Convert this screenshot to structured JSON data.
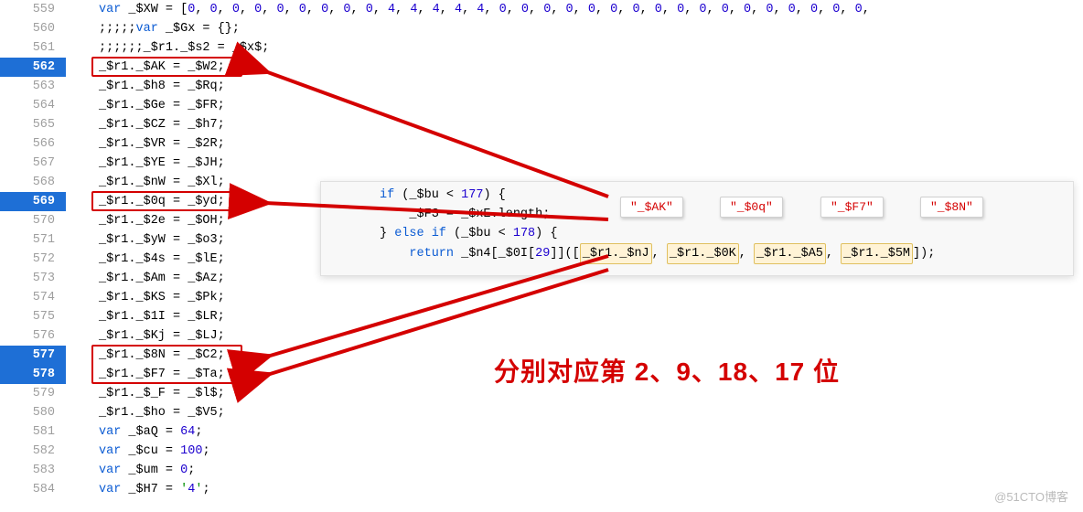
{
  "gutter": {
    "start": 559,
    "end": 584,
    "highlighted": [
      562,
      569,
      577,
      578
    ]
  },
  "code_lines": {
    "559": {
      "prefix": "var ",
      "body": "_$XW = [0, 0, 0, 0, 0, 0, 0, 0, 0, 4, 4, 4, 4, 4, 0, 0, 0, 0, 0, 0, 0, 0, 0, 0, 0, 0, 0, 0, 0, 0, 0,"
    },
    "560": {
      "body": ";;;;;var _$Gx = {};"
    },
    "561": {
      "body": ";;;;;;_$r1._$s2 = _$x$;"
    },
    "562": {
      "body": "_$r1._$AK = _$W2;"
    },
    "563": {
      "body": "_$r1._$h8 = _$Rq;"
    },
    "564": {
      "body": "_$r1._$Ge = _$FR;"
    },
    "565": {
      "body": "_$r1._$CZ = _$h7;"
    },
    "566": {
      "body": "_$r1._$VR = _$2R;"
    },
    "567": {
      "body": "_$r1._$YE = _$JH;"
    },
    "568": {
      "body": "_$r1._$nW = _$Xl;"
    },
    "569": {
      "body": "_$r1._$0q = _$yd;"
    },
    "570": {
      "body": "_$r1._$2e = _$OH;"
    },
    "571": {
      "body": "_$r1._$yW = _$o3;"
    },
    "572": {
      "body": "_$r1._$4s = _$lE;"
    },
    "573": {
      "body": "_$r1._$Am = _$Az;"
    },
    "574": {
      "body": "_$r1._$KS = _$Pk;"
    },
    "575": {
      "body": "_$r1._$1I = _$LR;"
    },
    "576": {
      "body": "_$r1._$Kj = _$LJ;"
    },
    "577": {
      "body": "_$r1._$8N = _$C2;"
    },
    "578": {
      "body": "_$r1._$F7 = _$Ta;"
    },
    "579": {
      "body": "_$r1._$_F = _$l$;"
    },
    "580": {
      "body": "_$r1._$ho = _$V5;"
    },
    "581": {
      "prefix": "var ",
      "body": "_$aQ = 64;"
    },
    "582": {
      "prefix": "var ",
      "body": "_$cu = 100;"
    },
    "583": {
      "prefix": "var ",
      "body": "_$um = 0;"
    },
    "584": {
      "prefix": "var ",
      "body": "_$H7 = '4';"
    }
  },
  "popup": {
    "line1_a": "if (_$bu < 177) {",
    "line2": "    _$F3 = _$xE.length;",
    "line3_a": "} ",
    "line3_b": "else if",
    "line3_c": " (_$bu < 178) {",
    "line4_a": "    return _$n4[_$0I[29]]([",
    "line4_chips": [
      "_$r1._$nJ",
      "_$r1._$0K",
      "_$r1._$A5",
      "_$r1._$5M"
    ],
    "line4_z": "]);",
    "tooltips": [
      "\"_$AK\"",
      "\"_$0q\"",
      "\"_$F7\"",
      "\"_$8N\""
    ]
  },
  "annotation": "分别对应第 2、9、18、17 位",
  "watermark": "@51CTO博客",
  "colors": {
    "highlight_bg": "#1e6fd6",
    "arrow_red": "#d40000",
    "tooltip_text": "#d40000",
    "keyword": "#0b5bd3",
    "number": "#1c00cf",
    "string": "#008f00",
    "chip_bg": "#fff3d6"
  }
}
